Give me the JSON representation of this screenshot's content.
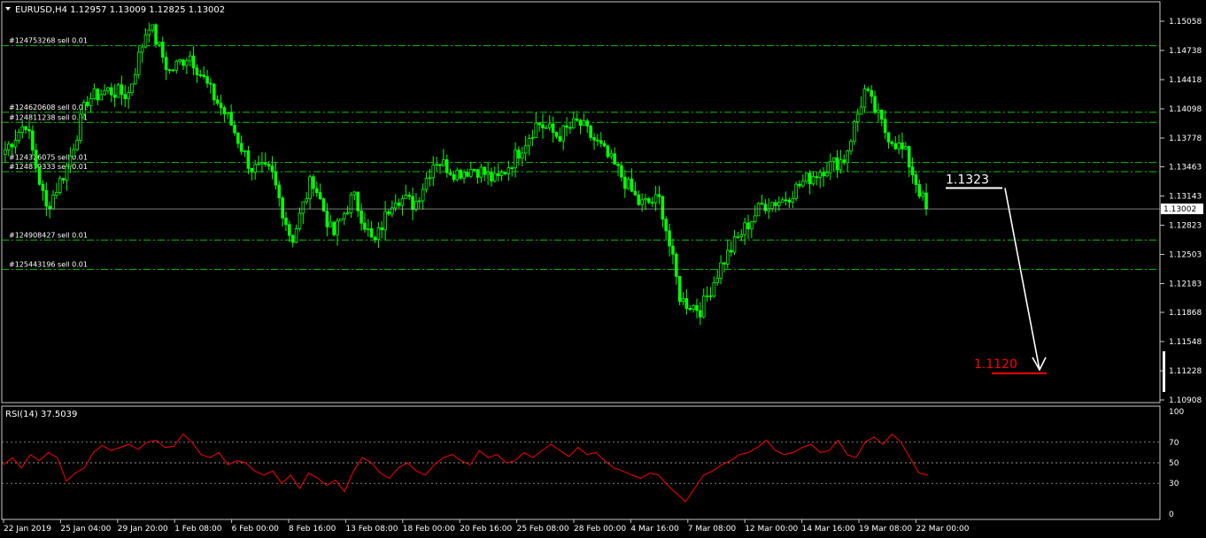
{
  "header": {
    "symbol_caption": "EURUSD,H4  1.12957 1.13009 1.12825 1.13002",
    "rsi_caption": "RSI(14) 37.5039"
  },
  "colors": {
    "background": "#000000",
    "candle": "#00ff00",
    "order_line": "#00c800",
    "rsi": "#ff0000",
    "frame": "#c8c8c8",
    "annotation_white": "#ffffff",
    "annotation_red": "#ff0000"
  },
  "chart_data": [
    {
      "type": "candlestick",
      "symbol": "EURUSD",
      "timeframe": "H4",
      "ohlc_last": {
        "open": 1.12957,
        "high": 1.13009,
        "low": 1.12825,
        "close": 1.13002
      },
      "ylim": [
        1.10908,
        1.15058
      ],
      "y_ticks": [
        "1.15058",
        "1.14738",
        "1.14418",
        "1.14098",
        "1.13778",
        "1.13463",
        "1.13143",
        "1.12823",
        "1.12503",
        "1.12183",
        "1.11868",
        "1.11548",
        "1.11228",
        "1.10908"
      ],
      "current_price_label": "1.13002",
      "current_price": 1.13002,
      "x_ticks": [
        "22 Jan 2019",
        "25 Jan 04:00",
        "29 Jan 20:00",
        "1 Feb 08:00",
        "6 Feb 00:00",
        "8 Feb 16:00",
        "13 Feb 08:00",
        "18 Feb 00:00",
        "20 Feb 16:00",
        "25 Feb 08:00",
        "28 Feb 00:00",
        "4 Mar 16:00",
        "7 Mar 08:00",
        "12 Mar 00:00",
        "14 Mar 16:00",
        "19 Mar 08:00",
        "22 Mar 00:00"
      ],
      "close_path": [
        {
          "x": "22 Jan 2019",
          "y": 1.1365
        },
        {
          "x": "24 Jan",
          "y": 1.1395
        },
        {
          "x": "24 Jan",
          "y": 1.13
        },
        {
          "x": "25 Jan 04:00",
          "y": 1.1345
        },
        {
          "x": "27 Jan",
          "y": 1.142
        },
        {
          "x": "28 Jan",
          "y": 1.143
        },
        {
          "x": "29 Jan",
          "y": 1.1425
        },
        {
          "x": "29 Jan 20:00",
          "y": 1.1505
        },
        {
          "x": "30 Jan",
          "y": 1.145
        },
        {
          "x": "1 Feb 08:00",
          "y": 1.147
        },
        {
          "x": "4 Feb",
          "y": 1.143
        },
        {
          "x": "5 Feb",
          "y": 1.1395
        },
        {
          "x": "6 Feb 00:00",
          "y": 1.1345
        },
        {
          "x": "7 Feb",
          "y": 1.134
        },
        {
          "x": "8 Feb 16:00",
          "y": 1.1265
        },
        {
          "x": "11 Feb",
          "y": 1.1335
        },
        {
          "x": "12 Feb",
          "y": 1.127
        },
        {
          "x": "13 Feb 08:00",
          "y": 1.1315
        },
        {
          "x": "14 Feb",
          "y": 1.126
        },
        {
          "x": "15 Feb",
          "y": 1.1315
        },
        {
          "x": "18 Feb 00:00",
          "y": 1.1305
        },
        {
          "x": "19 Feb",
          "y": 1.1355
        },
        {
          "x": "20 Feb 16:00",
          "y": 1.134
        },
        {
          "x": "21 Feb",
          "y": 1.1345
        },
        {
          "x": "22 Feb",
          "y": 1.133
        },
        {
          "x": "25 Feb 08:00",
          "y": 1.136
        },
        {
          "x": "26 Feb",
          "y": 1.1395
        },
        {
          "x": "27 Feb",
          "y": 1.138
        },
        {
          "x": "28 Feb 00:00",
          "y": 1.1395
        },
        {
          "x": "1 Mar",
          "y": 1.137
        },
        {
          "x": "4 Mar 16:00",
          "y": 1.134
        },
        {
          "x": "5 Mar",
          "y": 1.1305
        },
        {
          "x": "6 Mar",
          "y": 1.131
        },
        {
          "x": "7 Mar 08:00",
          "y": 1.12
        },
        {
          "x": "8 Mar",
          "y": 1.119
        },
        {
          "x": "11 Mar",
          "y": 1.124
        },
        {
          "x": "12 Mar 00:00",
          "y": 1.1275
        },
        {
          "x": "13 Mar",
          "y": 1.1305
        },
        {
          "x": "14 Mar 16:00",
          "y": 1.131
        },
        {
          "x": "15 Mar",
          "y": 1.133
        },
        {
          "x": "18 Mar",
          "y": 1.1345
        },
        {
          "x": "19 Mar 08:00",
          "y": 1.1355
        },
        {
          "x": "20 Mar",
          "y": 1.143
        },
        {
          "x": "21 Mar",
          "y": 1.1385
        },
        {
          "x": "22 Mar 00:00",
          "y": 1.136
        },
        {
          "x": "22 Mar",
          "y": 1.13
        }
      ],
      "order_lines": [
        {
          "label": "#124753268 sell 0.01",
          "price": 1.1479
        },
        {
          "label": "#124620608 sell 0.01",
          "price": 1.1406
        },
        {
          "label": "#124811238 sell 0.01",
          "price": 1.1395
        },
        {
          "label": "#124326075 sell 0.01",
          "price": 1.1351
        },
        {
          "label": "#124879333 sell 0.01",
          "price": 1.1341
        },
        {
          "label": "#124908427 sell 0.01",
          "price": 1.1266
        },
        {
          "label": "#125443196 sell 0.01",
          "price": 1.1234
        }
      ],
      "annotations": [
        {
          "text": "1.1323",
          "price": 1.1323,
          "color": "#ffffff"
        },
        {
          "text": "1.1120",
          "price": 1.112,
          "color": "#ff0000"
        }
      ]
    },
    {
      "type": "line",
      "name": "RSI(14)",
      "last_value": 37.5039,
      "ylim": [
        0,
        100
      ],
      "y_ticks": [
        "100",
        "70",
        "50",
        "30",
        "0"
      ],
      "levels": [
        30,
        50,
        70
      ],
      "values": [
        48,
        55,
        45,
        58,
        52,
        60,
        55,
        32,
        40,
        45,
        60,
        67,
        62,
        65,
        68,
        63,
        70,
        72,
        65,
        66,
        78,
        70,
        58,
        55,
        60,
        48,
        52,
        50,
        42,
        38,
        42,
        30,
        38,
        25,
        40,
        35,
        28,
        33,
        22,
        42,
        55,
        50,
        40,
        35,
        45,
        50,
        42,
        38,
        48,
        55,
        58,
        52,
        48,
        62,
        55,
        58,
        50,
        52,
        60,
        55,
        62,
        68,
        62,
        56,
        65,
        58,
        60,
        52,
        45,
        42,
        38,
        35,
        40,
        38,
        28,
        20,
        12,
        25,
        38,
        42,
        48,
        52,
        58,
        60,
        65,
        72,
        62,
        58,
        60,
        65,
        68,
        60,
        62,
        72,
        58,
        55,
        70,
        75,
        68,
        78,
        70,
        55,
        40,
        38
      ]
    }
  ]
}
